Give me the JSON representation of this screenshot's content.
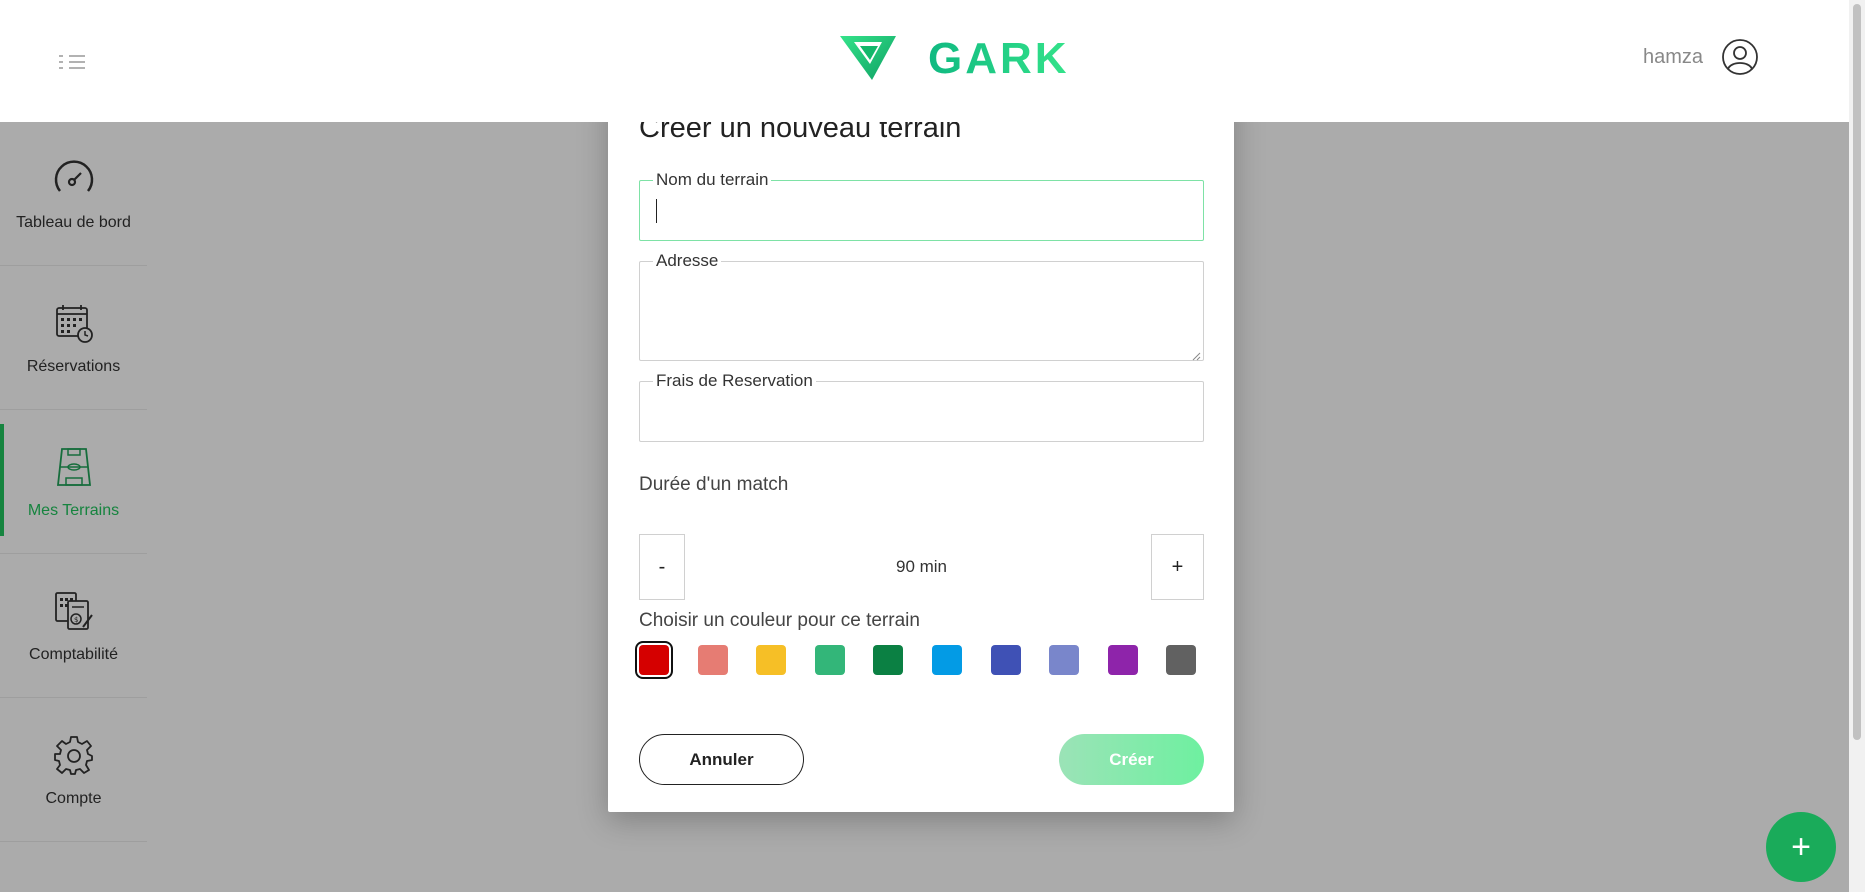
{
  "header": {
    "brand": "GARK",
    "user_name": "hamza",
    "icons": {
      "menu": "menu-toggle-icon",
      "logo": "gark-logo-icon",
      "avatar": "user-avatar-icon"
    }
  },
  "sidebar": {
    "items": [
      {
        "label": "Tableau de bord",
        "icon": "dashboard-gauge-icon",
        "active": false
      },
      {
        "label": "Réservations",
        "icon": "calendar-clock-icon",
        "active": false
      },
      {
        "label": "Mes Terrains",
        "icon": "soccer-field-icon",
        "active": true
      },
      {
        "label": "Comptabilité",
        "icon": "accounting-calculator-icon",
        "active": false
      },
      {
        "label": "Compte",
        "icon": "gear-icon",
        "active": false
      }
    ]
  },
  "modal": {
    "title": "Creer un nouveau terrain",
    "fields": {
      "name": {
        "label": "Nom du terrain",
        "value": ""
      },
      "address": {
        "label": "Adresse",
        "value": ""
      },
      "fee": {
        "label": "Frais de Reservation",
        "value": ""
      }
    },
    "duration": {
      "label": "Durée d'un match",
      "decrement": "-",
      "value": "90 min",
      "increment": "+"
    },
    "color_picker": {
      "label": "Choisir un couleur pour ce terrain",
      "colors": [
        "#d50000",
        "#e67c73",
        "#f6bf26",
        "#33b679",
        "#0b8043",
        "#039be5",
        "#3f51b5",
        "#7986cb",
        "#8e24aa",
        "#616161"
      ],
      "selected_index": 0
    },
    "actions": {
      "cancel": "Annuler",
      "create": "Créer"
    }
  },
  "fab": {
    "label": "+"
  },
  "colors": {
    "accent": "#22c55e",
    "fab": "#1aab5a"
  }
}
